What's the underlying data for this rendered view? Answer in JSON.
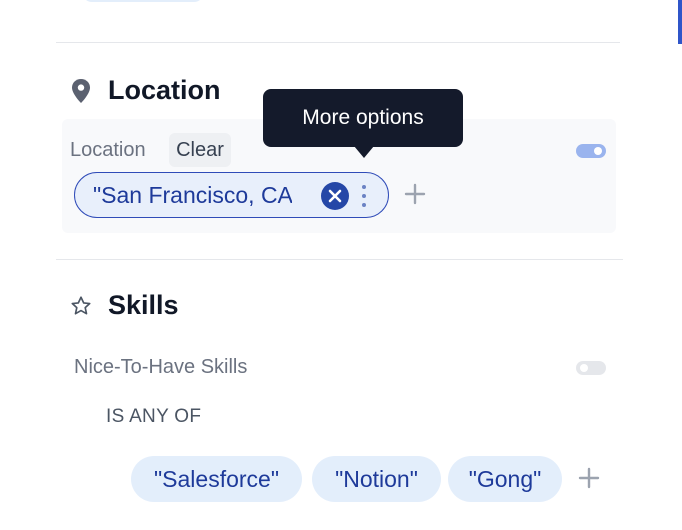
{
  "location_section": {
    "title": "Location",
    "icon": "map-pin-icon",
    "field_label": "Location",
    "clear_label": "Clear",
    "toggle_on": true,
    "chip_value": "\"San Francisco, CA",
    "tooltip": "More options"
  },
  "skills_section": {
    "title": "Skills",
    "icon": "star-icon",
    "field_label": "Nice-To-Have Skills",
    "toggle_on": false,
    "operator": "IS ANY OF",
    "skills": [
      "\"Salesforce\"",
      "\"Notion\"",
      "\"Gong\""
    ]
  },
  "colors": {
    "chip_bg": "#e3eefb",
    "chip_text": "#1e3a9a",
    "accent": "#2547a7",
    "tooltip_bg": "#141a2b"
  }
}
